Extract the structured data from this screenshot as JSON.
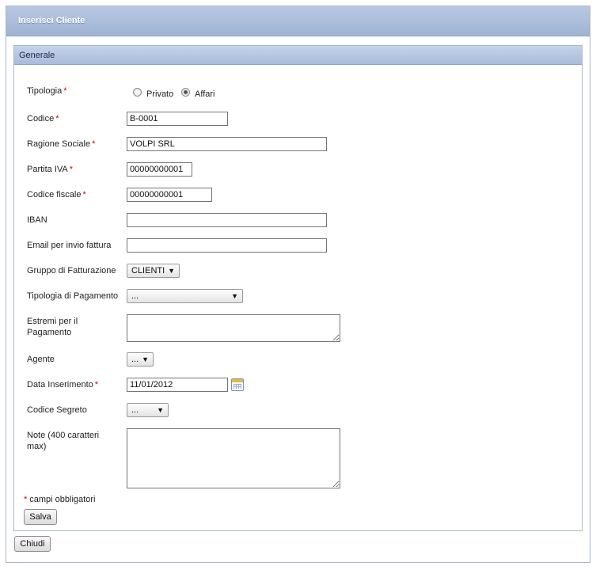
{
  "window": {
    "title": "Inserisci Cliente"
  },
  "section": {
    "title": "Generale"
  },
  "form": {
    "tipologia": {
      "label": "Tipologia",
      "options": [
        "Privato",
        "Affari"
      ],
      "selected": "Affari"
    },
    "codice": {
      "label": "Codice",
      "value": "B-0001"
    },
    "ragione_sociale": {
      "label": "Ragione Sociale",
      "value": "VOLPI SRL"
    },
    "partita_iva": {
      "label": "Partita IVA",
      "value": "00000000001"
    },
    "codice_fiscale": {
      "label": "Codice fiscale",
      "value": "00000000001"
    },
    "iban": {
      "label": "IBAN",
      "value": ""
    },
    "email": {
      "label": "Email per invio fattura",
      "value": ""
    },
    "gruppo": {
      "label": "Gruppo di Fatturazione",
      "value": "CLIENTI"
    },
    "tipologia_pagamento": {
      "label": "Tipologia di Pagamento",
      "value": "..."
    },
    "estremi": {
      "label_line1": "Estremi per il",
      "label_line2": "Pagamento",
      "value": ""
    },
    "agente": {
      "label": "Agente",
      "value": "..."
    },
    "data_inserimento": {
      "label": "Data Inserimento",
      "value": "11/01/2012"
    },
    "codice_segreto": {
      "label": "Codice Segreto",
      "value": "..."
    },
    "note": {
      "label_line1": "Note (400 caratteri",
      "label_line2": "max)",
      "value": ""
    },
    "required_marker": "*",
    "required_note": "campi obbligatori",
    "save_label": "Salva"
  },
  "footer": {
    "close_label": "Chiudi"
  },
  "colors": {
    "header": "#a9bcdc",
    "required": "#d40000",
    "border": "#a9b6cc"
  },
  "icons": {
    "calendar": "calendar-icon",
    "dropdown": "chevron-down-icon"
  }
}
